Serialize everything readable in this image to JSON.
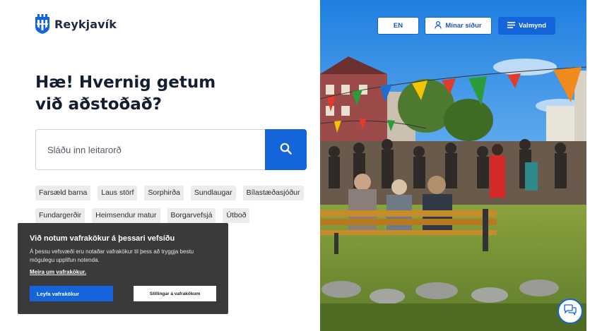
{
  "header": {
    "logo_text": "Reykjavík",
    "lang_button": "EN",
    "my_pages_button": "Mínar síður",
    "menu_button": "Valmynd"
  },
  "hero": {
    "title": "Hæ! Hvernig getum við aðstoðað?"
  },
  "search": {
    "placeholder": "Sláðu inn leitarorð"
  },
  "tags": [
    "Farsæld barna",
    "Laus störf",
    "Sorphirða",
    "Sundlaugar",
    "Bílastæðasjóður",
    "Fundargerðir",
    "Heimsendur matur",
    "Borgarvefsjá",
    "Útboð"
  ],
  "cookie": {
    "title": "Við notum vafrakökur á þessari vefsíðu",
    "body": "Á þessu vefsvæði eru notaðar vafrakökur til þess að tryggja bestu mögulegu upplifun notenda.",
    "more_link": "Meira um vafrakökur.",
    "accept_button": "Leyfa vafrakökur",
    "settings_button": "Stillingar á vafrakökum"
  },
  "colors": {
    "accent": "#1464dc",
    "cookie_bg": "#3a3a3a",
    "tag_bg": "#ececec",
    "title": "#141e33"
  },
  "icons": {
    "logo": "reykjavik-shield-icon",
    "search": "search-icon",
    "user": "user-icon",
    "menu": "hamburger-icon",
    "chat": "chat-bubbles-icon"
  }
}
